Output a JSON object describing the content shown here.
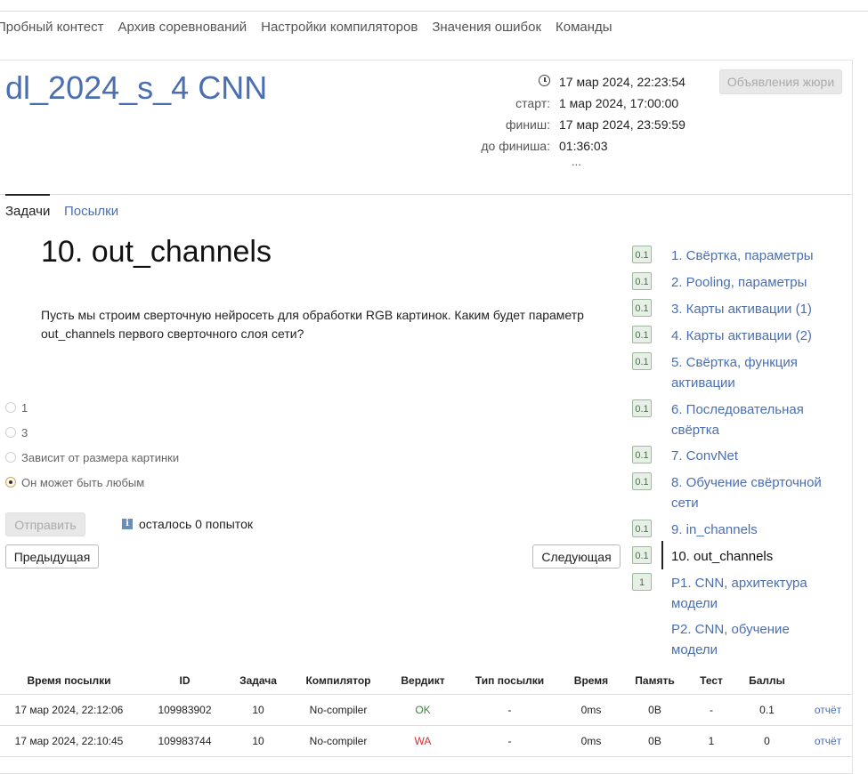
{
  "nav": {
    "items": [
      "Пробный контест",
      "Архив соревнований",
      "Настройки компиляторов",
      "Значения ошибок",
      "Команды"
    ]
  },
  "contest": {
    "title": "dl_2024_s_4 CNN",
    "current_time": "17 мар 2024, 22:23:54",
    "start_label": "старт:",
    "start": "1 мар 2024, 17:00:00",
    "finish_label": "финиш:",
    "finish": "17 мар 2024, 23:59:59",
    "remaining_label": "до финиша:",
    "remaining": "01:36:03",
    "more": "...",
    "jury_button": "Объявления жюри"
  },
  "tabs": {
    "tasks": "Задачи",
    "submissions": "Посылки"
  },
  "problem": {
    "title": "10. out_channels",
    "statement": "Пусть мы строим сверточную нейросеть для обработки RGB картинок. Каким будет параметр out_channels первого сверточного слоя сети?",
    "options": [
      {
        "label": "1",
        "checked": false
      },
      {
        "label": "3",
        "checked": false
      },
      {
        "label": "Зависит от размера картинки",
        "checked": false
      },
      {
        "label": "Он может быть любым",
        "checked": true
      }
    ],
    "submit": "Отправить",
    "attempts": "осталось 0 попыток",
    "prev": "Предыдущая",
    "next": "Следующая"
  },
  "problem_list": [
    {
      "badge": "0.1",
      "name": "1. Свёртка, параметры"
    },
    {
      "badge": "0.1",
      "name": "2. Pooling, параметры"
    },
    {
      "badge": "0.1",
      "name": "3. Карты активации (1)"
    },
    {
      "badge": "0.1",
      "name": "4. Карты активации (2)"
    },
    {
      "badge": "0.1",
      "name": "5. Свёртка, функция активации"
    },
    {
      "badge": "0.1",
      "name": "6. Последовательная свёртка"
    },
    {
      "badge": "0.1",
      "name": "7. ConvNet"
    },
    {
      "badge": "0.1",
      "name": "8. Обучение свёрточной сети"
    },
    {
      "badge": "0.1",
      "name": "9. in_channels"
    },
    {
      "badge": "0.1",
      "name": "10. out_channels",
      "active": true
    },
    {
      "badge": "1",
      "name": "P1. CNN, архитектура модели"
    },
    {
      "badge": "",
      "name": "P2. CNN, обучение модели"
    }
  ],
  "submissions": {
    "headers": [
      "Время посылки",
      "ID",
      "Задача",
      "Компилятор",
      "Вердикт",
      "Тип посылки",
      "Время",
      "Память",
      "Тест",
      "Баллы",
      ""
    ],
    "rows": [
      [
        "17 мар 2024, 22:12:06",
        "109983902",
        "10",
        "No-compiler",
        "OK",
        "-",
        "0ms",
        "0B",
        "-",
        "0.1",
        "отчёт"
      ],
      [
        "17 мар 2024, 22:10:45",
        "109983744",
        "10",
        "No-compiler",
        "WA",
        "-",
        "0ms",
        "0B",
        "1",
        "0",
        "отчёт"
      ]
    ]
  }
}
